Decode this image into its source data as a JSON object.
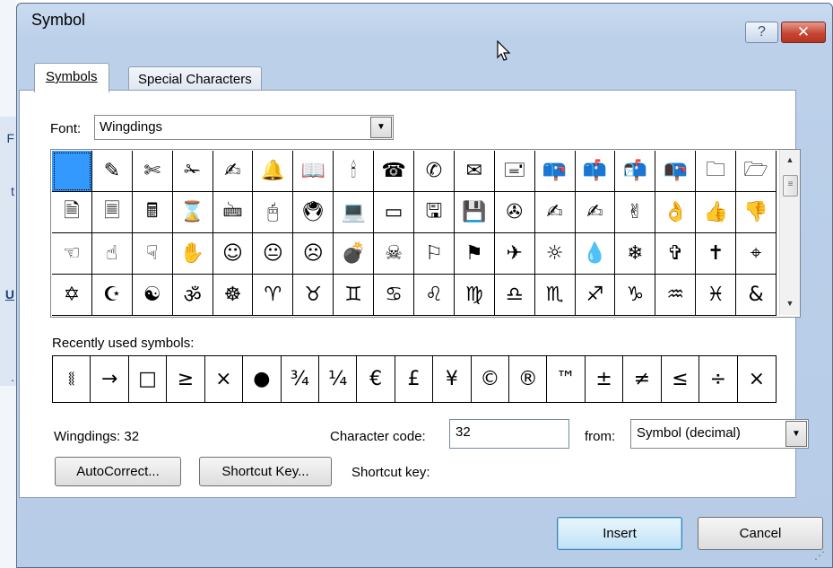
{
  "background_app": {
    "letters": [
      "F",
      "t",
      "U",
      "."
    ]
  },
  "dialog": {
    "title": "Symbol",
    "help_label": "?",
    "close_label": "✕",
    "tabs": [
      {
        "label": "Symbols",
        "active": true
      },
      {
        "label": "Special Characters",
        "active": false
      }
    ],
    "font_label": "Font:",
    "font_value": "Wingdings",
    "symbol_grid": [
      " ",
      "✎",
      "✄",
      "✁",
      "✍",
      "🔔",
      "📖",
      "🕯",
      "☎",
      "✆",
      "✉",
      "🖃",
      "📪",
      "📫",
      "📬",
      "📭",
      "🗀",
      "🗁",
      "🗎",
      "🗏",
      "🖩",
      "⌛",
      "🖮",
      "🖰",
      "🖲",
      "💻",
      "▭",
      "🖫",
      "💾",
      "✇",
      "✍",
      "✍",
      "✌",
      "👌",
      "👍",
      "👎",
      "☜",
      "☝",
      "☟",
      "✋",
      "☺",
      "😐",
      "☹",
      "💣",
      "☠",
      "⚐",
      "⚑",
      "✈",
      "☼",
      "💧",
      "❄",
      "✞",
      "✝",
      "⌖",
      "✡",
      "☪",
      "☯",
      "ॐ",
      "☸",
      "♈",
      "♉",
      "♊",
      "♋",
      "♌",
      "♍",
      "♎",
      "♏",
      "♐",
      "♑",
      "♒",
      "♓",
      "&"
    ],
    "recent_label": "Recently used symbols:",
    "recent_symbols": [
      "⧛",
      "→",
      "□",
      "≥",
      "×",
      "●",
      "¾",
      "¼",
      "€",
      "£",
      "¥",
      "©",
      "®",
      "™",
      "±",
      "≠",
      "≤",
      "÷",
      "×"
    ],
    "char_name": "Wingdings: 32",
    "char_code_label": "Character code:",
    "char_code_value": "32",
    "from_label": "from:",
    "from_value": "Symbol (decimal)",
    "autocorrect_label": "AutoCorrect...",
    "shortcut_key_button_label": "Shortcut Key...",
    "shortcut_key_label": "Shortcut key:",
    "insert_label": "Insert",
    "cancel_label": "Cancel"
  }
}
